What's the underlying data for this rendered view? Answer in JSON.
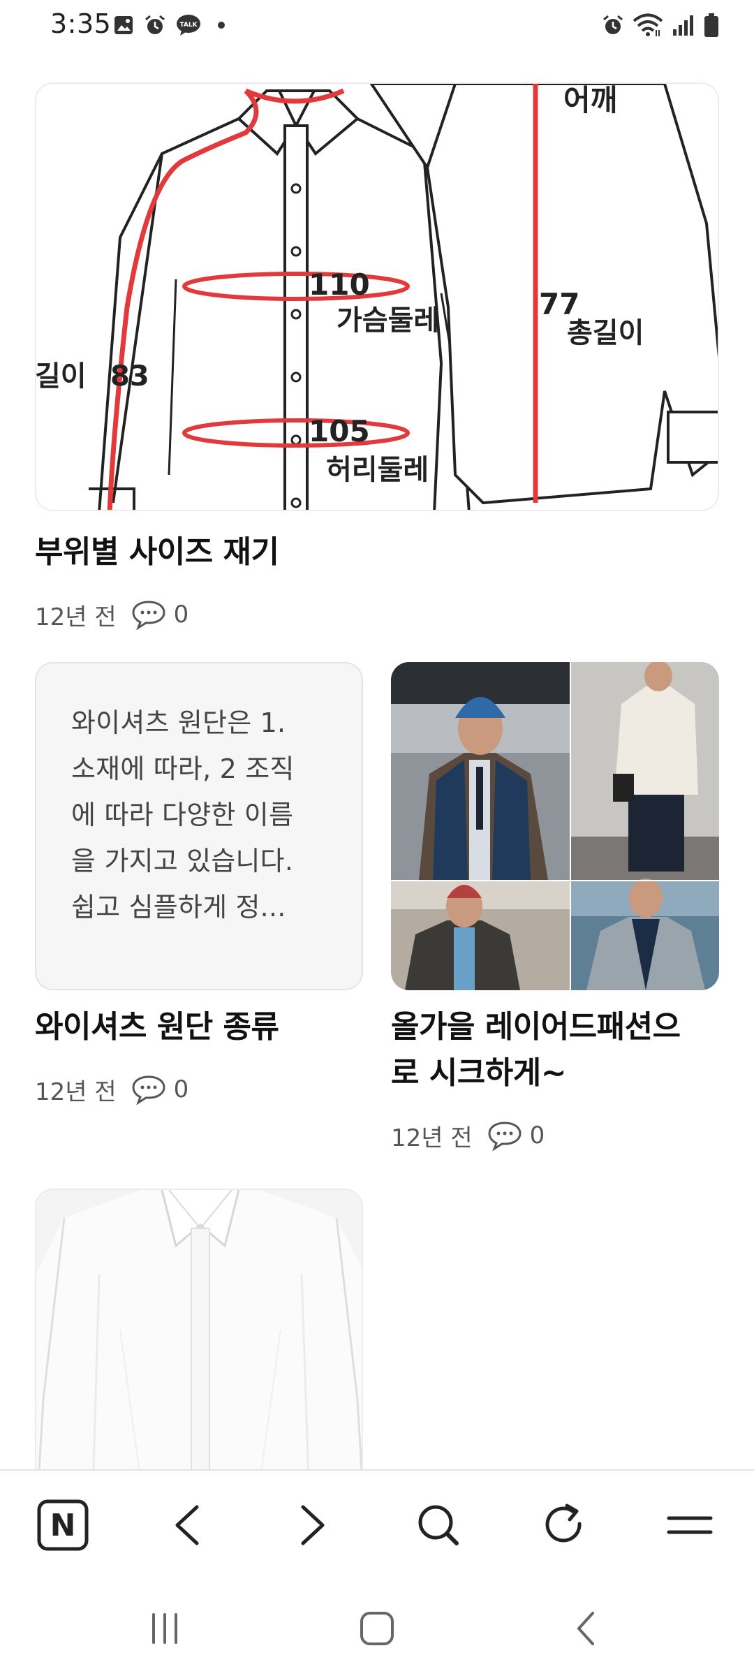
{
  "status_bar": {
    "time": "3:35",
    "left_icons": [
      "image-icon",
      "alarm-icon",
      "kakaotalk-icon",
      "dot-icon"
    ],
    "kakaotalk_label": "TALK",
    "right_icons": [
      "alarm-icon",
      "wifi-icon",
      "signal-icon",
      "battery-icon"
    ]
  },
  "posts": [
    {
      "title": "부위별 사이즈 재기",
      "age": "12년 전",
      "comments": "0",
      "thumbnail": "shirt-measurement-diagram",
      "diagram_labels": {
        "shoulder": "어깨",
        "chest_value": "110",
        "chest": "가슴둘레",
        "length_value": "77",
        "length": "총길이",
        "sleeve": "길이",
        "sleeve_value": "83",
        "waist_value": "105",
        "waist": "허리둘레"
      }
    },
    {
      "title": "와이셔츠 원단 종류",
      "age": "12년 전",
      "comments": "0",
      "excerpt_lines": [
        "와이셔츠 원단은 1.",
        "소재에 따라, 2 조직",
        "에 따라 다양한 이름",
        "을 가지고 있습니다.",
        "쉽고 심플하게 정..."
      ]
    },
    {
      "title_lines": [
        "올가을 레이어드패션으",
        "로 시크하게~"
      ],
      "age": "12년 전",
      "comments": "0",
      "thumbnail": "layered-fashion-collage"
    },
    {
      "thumbnail": "white-dress-shirt-photo"
    }
  ],
  "toolbar": {
    "buttons": [
      "naver-home-icon",
      "back-icon",
      "forward-icon",
      "search-icon",
      "refresh-icon",
      "menu-icon"
    ],
    "naver_letter": "N"
  },
  "navbar": {
    "buttons": [
      "recent-apps-icon",
      "home-icon",
      "back-icon"
    ]
  },
  "colors": {
    "measure_red": "#e23a3a",
    "text_primary": "#111111",
    "text_secondary": "#555555",
    "divider": "#e3e3e3"
  }
}
